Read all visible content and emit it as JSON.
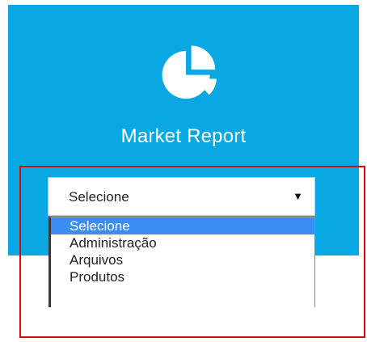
{
  "header": {
    "logo_icon": "pie-chart-icon",
    "title": "Market Report"
  },
  "select": {
    "value": "Selecione",
    "arrow": "▼"
  },
  "dropdown": {
    "options": [
      {
        "label": "Selecione",
        "selected": true
      },
      {
        "label": "Administração",
        "selected": false
      },
      {
        "label": "Arquivos",
        "selected": false
      },
      {
        "label": "Produtos",
        "selected": false
      }
    ]
  },
  "colors": {
    "panel": "#0aa8e3",
    "selected_option": "#3b8df3",
    "highlight": "#d20b0b"
  }
}
